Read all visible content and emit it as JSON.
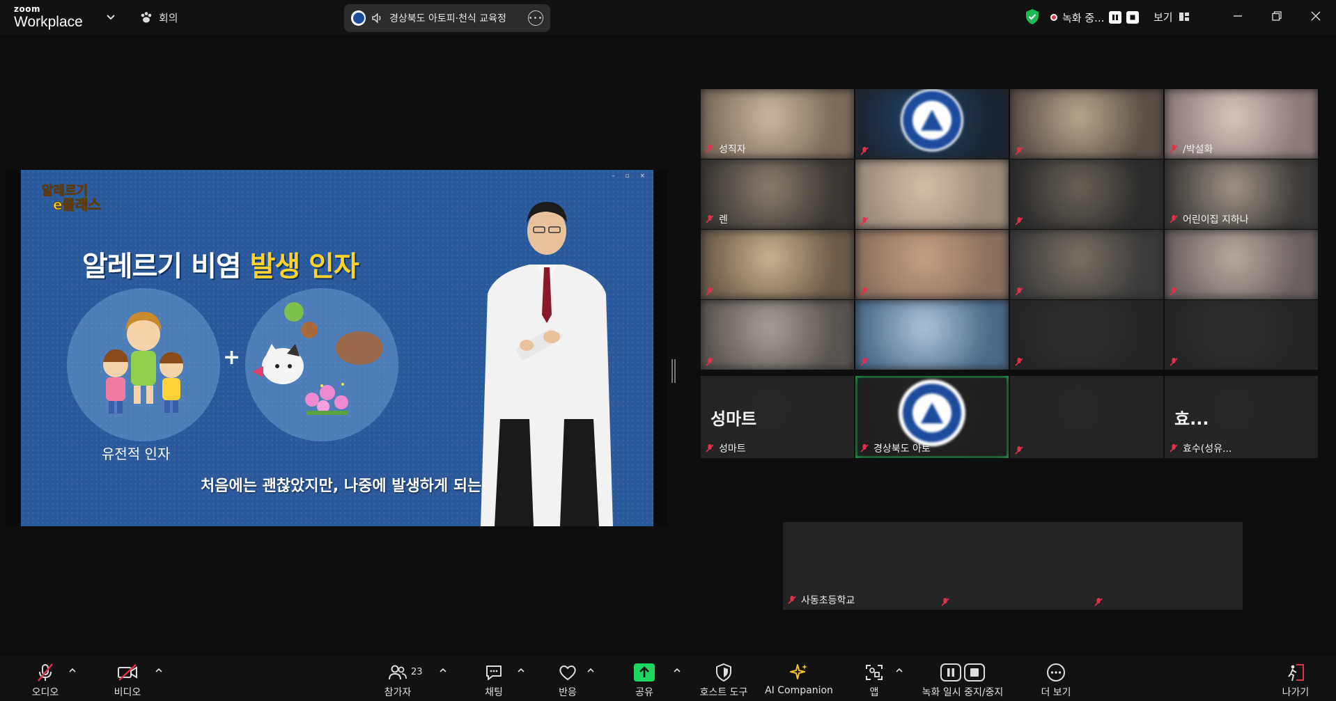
{
  "app": {
    "brand_small": "zoom",
    "brand_large": "Workplace",
    "meeting_tab": "회의",
    "meeting_title": "경상북도 아토피·천식 교육정",
    "recording_status": "녹화 중...",
    "view_label": "보기"
  },
  "slide": {
    "logo_line1": "알레르기",
    "logo_line2": "e클래스",
    "title_main": "알레르기 비염 ",
    "title_highlight": "발생 인자",
    "genetic_label": "유전적 인자",
    "plus": "+",
    "subtitle": "처음에는 괜찮았지만, 나중에 발생하게 되는 게"
  },
  "gallery": {
    "tiles": [
      {
        "name": "성직자",
        "big": ""
      },
      {
        "name": "",
        "big": ""
      },
      {
        "name": "",
        "big": ""
      },
      {
        "name": "/박설화",
        "big": ""
      },
      {
        "name": "렌",
        "big": ""
      },
      {
        "name": "",
        "big": ""
      },
      {
        "name": "",
        "big": ""
      },
      {
        "name": "어린이집 지하나",
        "big": ""
      },
      {
        "name": "",
        "big": ""
      },
      {
        "name": "",
        "big": ""
      },
      {
        "name": "",
        "big": ""
      },
      {
        "name": "",
        "big": ""
      },
      {
        "name": "",
        "big": ""
      },
      {
        "name": "",
        "big": ""
      },
      {
        "name": "",
        "big": ""
      },
      {
        "name": "",
        "big": ""
      },
      {
        "name": "성마트",
        "big": "성마트"
      },
      {
        "name": "경상북도 아토",
        "big": ""
      },
      {
        "name": "",
        "big": ""
      },
      {
        "name": "효수(성유...",
        "big": "효..."
      }
    ],
    "row2": [
      {
        "name": "사동초등학교",
        "big": ""
      },
      {
        "name": "",
        "big": ""
      },
      {
        "name": "",
        "big": ""
      }
    ]
  },
  "toolbar": {
    "audio": "오디오",
    "video": "비디오",
    "participants": "참가자",
    "participants_count": "23",
    "chat": "채팅",
    "react": "반응",
    "share": "공유",
    "host_tools": "호스트 도구",
    "ai_companion": "AI Companion",
    "apps": "앱",
    "record_pause": "녹화 일시 중지/중지",
    "more": "더 보기",
    "leave": "나가기"
  },
  "colors": {
    "accent_green": "#1db954",
    "share_green": "#1ed760",
    "muted_red": "#e2314a",
    "slide_blue": "#2a5a9c",
    "highlight_yellow": "#ffd12b"
  }
}
